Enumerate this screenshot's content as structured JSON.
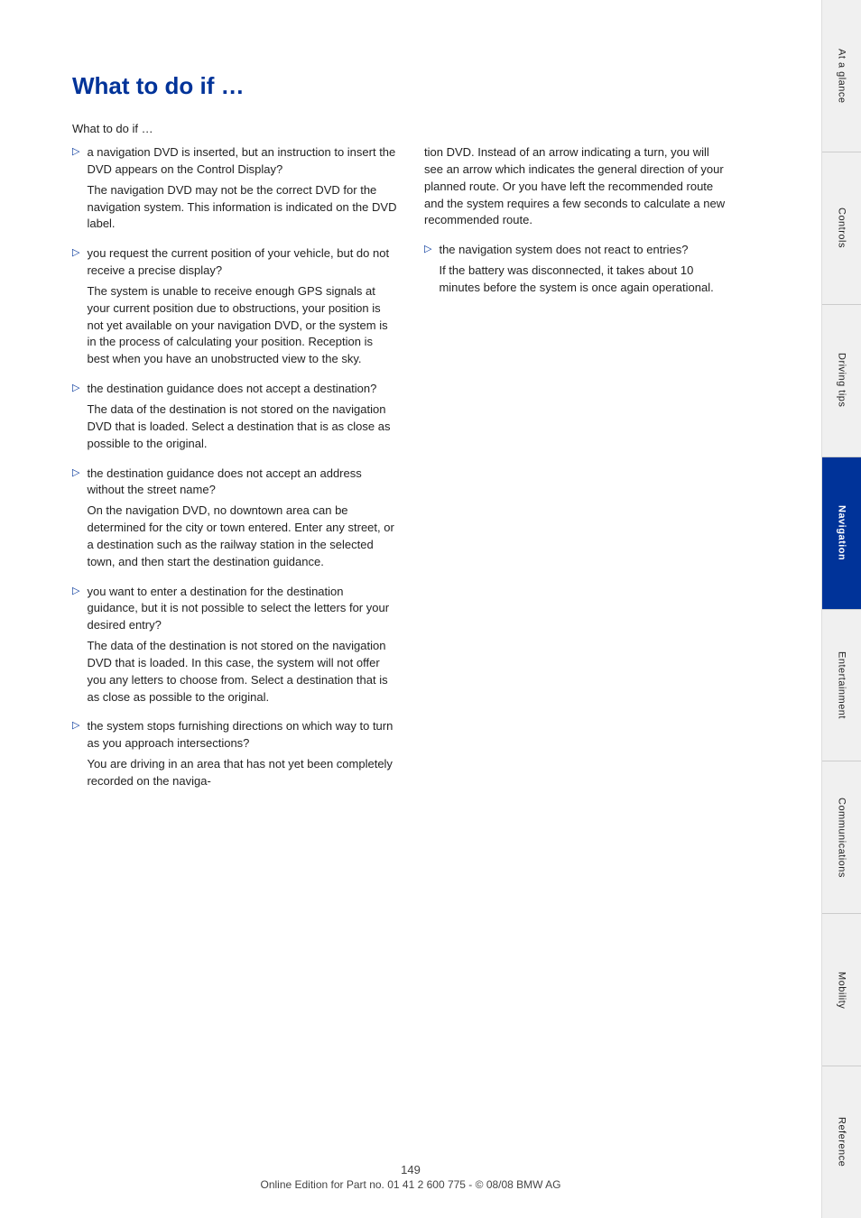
{
  "page": {
    "title": "What to do if …",
    "intro": "What to do if …",
    "page_number": "149",
    "footer_text": "Online Edition for Part no. 01 41 2 600 775 - © 08/08 BMW AG"
  },
  "left_column": {
    "bullets": [
      {
        "question": "a navigation DVD is inserted, but an instruction to insert the DVD appears on the Control Display?",
        "answer": "The navigation DVD may not be the correct DVD for the navigation system. This information is indicated on the DVD label."
      },
      {
        "question": "you request the current position of your vehicle, but do not receive a precise display?",
        "answer": "The system is unable to receive enough GPS signals at your current position due to obstructions, your position is not yet available on your navigation DVD, or the system is in the process of calculating your position. Reception is best when you have an unobstructed view to the sky."
      },
      {
        "question": "the destination guidance does not accept a destination?",
        "answer": "The data of the destination is not stored on the navigation DVD that is loaded. Select a destination that is as close as possible to the original."
      },
      {
        "question": "the destination guidance does not accept an address without the street name?",
        "answer": "On the navigation DVD, no downtown area can be determined for the city or town entered. Enter any street, or a destination such as the railway station in the selected town, and then start the destination guidance."
      },
      {
        "question": "you want to enter a destination for the destination guidance, but it is not possible to select the letters for your desired entry?",
        "answer": "The data of the destination is not stored on the navigation DVD that is loaded. In this case, the system will not offer you any letters to choose from. Select a destination that is as close as possible to the original."
      },
      {
        "question": "the system stops furnishing directions on which way to turn as you approach intersections?",
        "answer": "You are driving in an area that has not yet been completely recorded on the naviga-"
      }
    ]
  },
  "right_column": {
    "intro": "tion DVD. Instead of an arrow indicating a turn, you will see an arrow which indicates the general direction of your planned route. Or you have left the recommended route and the system requires a few seconds to calculate a new recommended route.",
    "bullets": [
      {
        "question": "the navigation system does not react to entries?",
        "answer": "If the battery was disconnected, it takes about 10 minutes before the system is once again operational."
      }
    ]
  },
  "sidebar": {
    "tabs": [
      {
        "label": "At a glance",
        "active": false
      },
      {
        "label": "Controls",
        "active": false
      },
      {
        "label": "Driving tips",
        "active": false
      },
      {
        "label": "Navigation",
        "active": true
      },
      {
        "label": "Entertainment",
        "active": false
      },
      {
        "label": "Communications",
        "active": false
      },
      {
        "label": "Mobility",
        "active": false
      },
      {
        "label": "Reference",
        "active": false
      }
    ]
  }
}
